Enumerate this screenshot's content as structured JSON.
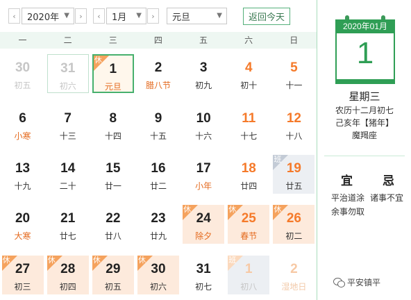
{
  "toolbar": {
    "prev_year": "‹",
    "year": "2020年",
    "next_year": "›",
    "prev_month": "‹",
    "month": "1月",
    "next_month": "›",
    "holiday": "元旦",
    "today_label": "返回今天"
  },
  "weekdays": [
    "一",
    "二",
    "三",
    "四",
    "五",
    "六",
    "日"
  ],
  "days": [
    {
      "n": "30",
      "l": "初五",
      "other": true
    },
    {
      "n": "31",
      "l": "初六",
      "other": true,
      "prevsel": true
    },
    {
      "n": "1",
      "l": "元旦",
      "selected": true,
      "fest": true,
      "tag": "休"
    },
    {
      "n": "2",
      "l": "腊八节",
      "fest": true
    },
    {
      "n": "3",
      "l": "初九"
    },
    {
      "n": "4",
      "l": "初十",
      "weekend": true
    },
    {
      "n": "5",
      "l": "十一",
      "weekend": true
    },
    {
      "n": "6",
      "l": "小寒",
      "fest": true
    },
    {
      "n": "7",
      "l": "十三"
    },
    {
      "n": "8",
      "l": "十四"
    },
    {
      "n": "9",
      "l": "十五"
    },
    {
      "n": "10",
      "l": "十六"
    },
    {
      "n": "11",
      "l": "十七",
      "weekend": true
    },
    {
      "n": "12",
      "l": "十八",
      "weekend": true
    },
    {
      "n": "13",
      "l": "十九"
    },
    {
      "n": "14",
      "l": "二十"
    },
    {
      "n": "15",
      "l": "廿一"
    },
    {
      "n": "16",
      "l": "廿二"
    },
    {
      "n": "17",
      "l": "小年",
      "fest": true
    },
    {
      "n": "18",
      "l": "廿四",
      "weekend": true
    },
    {
      "n": "19",
      "l": "廿五",
      "weekend": true,
      "work": true,
      "tag": "班"
    },
    {
      "n": "20",
      "l": "大寒",
      "fest": true
    },
    {
      "n": "21",
      "l": "廿七"
    },
    {
      "n": "22",
      "l": "廿八"
    },
    {
      "n": "23",
      "l": "廿九"
    },
    {
      "n": "24",
      "l": "除夕",
      "fest": true,
      "hol": true,
      "tag": "休"
    },
    {
      "n": "25",
      "l": "春节",
      "fest": true,
      "hol": true,
      "weekend": true,
      "tag": "休"
    },
    {
      "n": "26",
      "l": "初二",
      "hol": true,
      "weekend": true,
      "tag": "休"
    },
    {
      "n": "27",
      "l": "初三",
      "hol": true,
      "tag": "休"
    },
    {
      "n": "28",
      "l": "初四",
      "hol": true,
      "tag": "休"
    },
    {
      "n": "29",
      "l": "初五",
      "hol": true,
      "tag": "休"
    },
    {
      "n": "30",
      "l": "初六",
      "hol": true,
      "tag": "休"
    },
    {
      "n": "31",
      "l": "初七"
    },
    {
      "n": "1",
      "l": "初八",
      "other": true,
      "work": true,
      "weekend": true,
      "tag": "班"
    },
    {
      "n": "2",
      "l": "湿地日",
      "other": true,
      "fest": true,
      "weekend": true
    }
  ],
  "panel": {
    "header": "2020年01月",
    "day": "1",
    "weekday": "星期三",
    "lunar": "农历十二月初七",
    "ganzhi": "己亥年【猪年】",
    "constellation": "魔羯座",
    "yi_label": "宜",
    "ji_label": "忌",
    "yi_text": "平治道涂",
    "ji_text": "诸事不宜",
    "ji_text2": "余事勿取"
  },
  "watermark": "平安镇平",
  "colors": {
    "accent": "#2f9e55",
    "festival": "#e46a1e",
    "weekend": "#f57a2a",
    "holiday_bg": "#fdeadc"
  }
}
